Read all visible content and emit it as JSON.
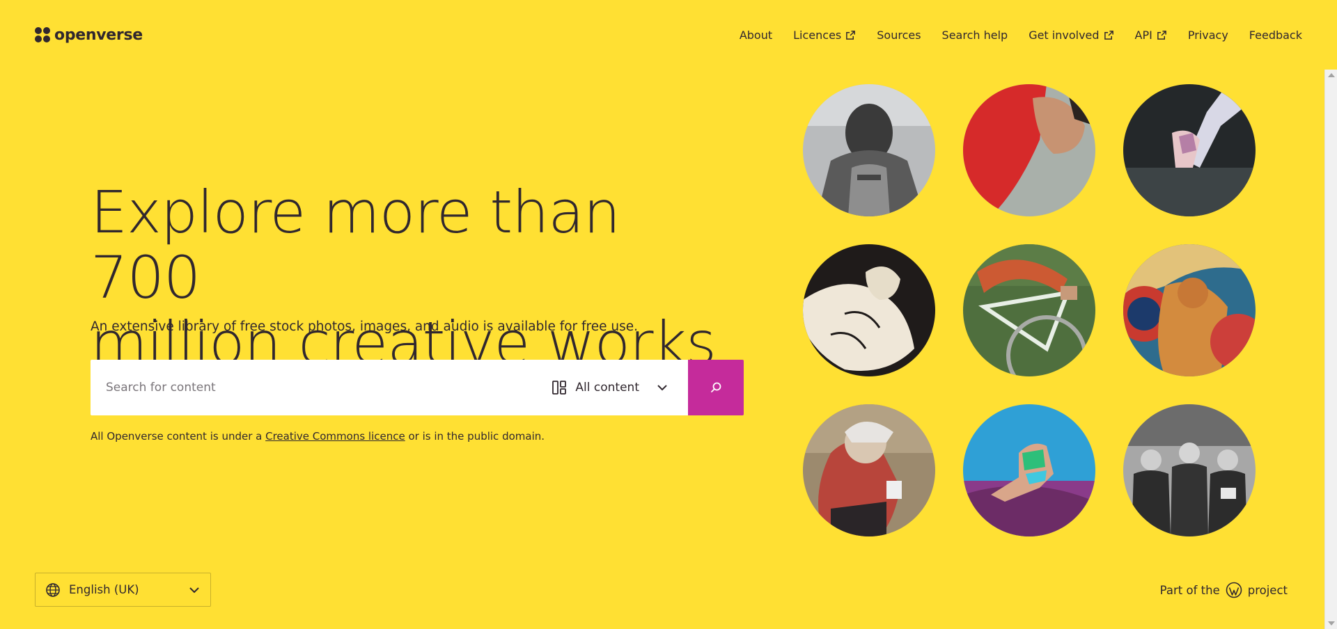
{
  "header": {
    "logo_text": "openverse",
    "nav": [
      {
        "label": "About",
        "external": false
      },
      {
        "label": "Licences",
        "external": true
      },
      {
        "label": "Sources",
        "external": false
      },
      {
        "label": "Search help",
        "external": false
      },
      {
        "label": "Get involved",
        "external": true
      },
      {
        "label": "API",
        "external": true
      },
      {
        "label": "Privacy",
        "external": false
      },
      {
        "label": "Feedback",
        "external": false
      }
    ]
  },
  "hero": {
    "title_line1": "Explore more than 700",
    "title_line2": "million creative works",
    "subtitle": "An extensive library of free stock photos, images, and audio is available for free use."
  },
  "search": {
    "placeholder": "Search for content",
    "content_type": "All content"
  },
  "licence_note": {
    "prefix": "All Openverse content is under a ",
    "link": "Creative Commons licence",
    "suffix": " or is in the public domain."
  },
  "gallery": [
    {
      "name": "athlete-portrait-bw-image"
    },
    {
      "name": "red-shirt-athlete-image"
    },
    {
      "name": "gymnast-hands-image"
    },
    {
      "name": "wrestlers-engraving-image"
    },
    {
      "name": "track-cyclist-image"
    },
    {
      "name": "athlete-poster-image"
    },
    {
      "name": "cyclist-helmet-image"
    },
    {
      "name": "long-jumper-image"
    },
    {
      "name": "women-athletes-bw-image"
    }
  ],
  "footer": {
    "language": "English (UK)",
    "credit_prefix": "Part of the",
    "credit_suffix": "project"
  },
  "colors": {
    "background": "#ffe033",
    "text": "#30272e",
    "search_button": "#c52b9b"
  }
}
